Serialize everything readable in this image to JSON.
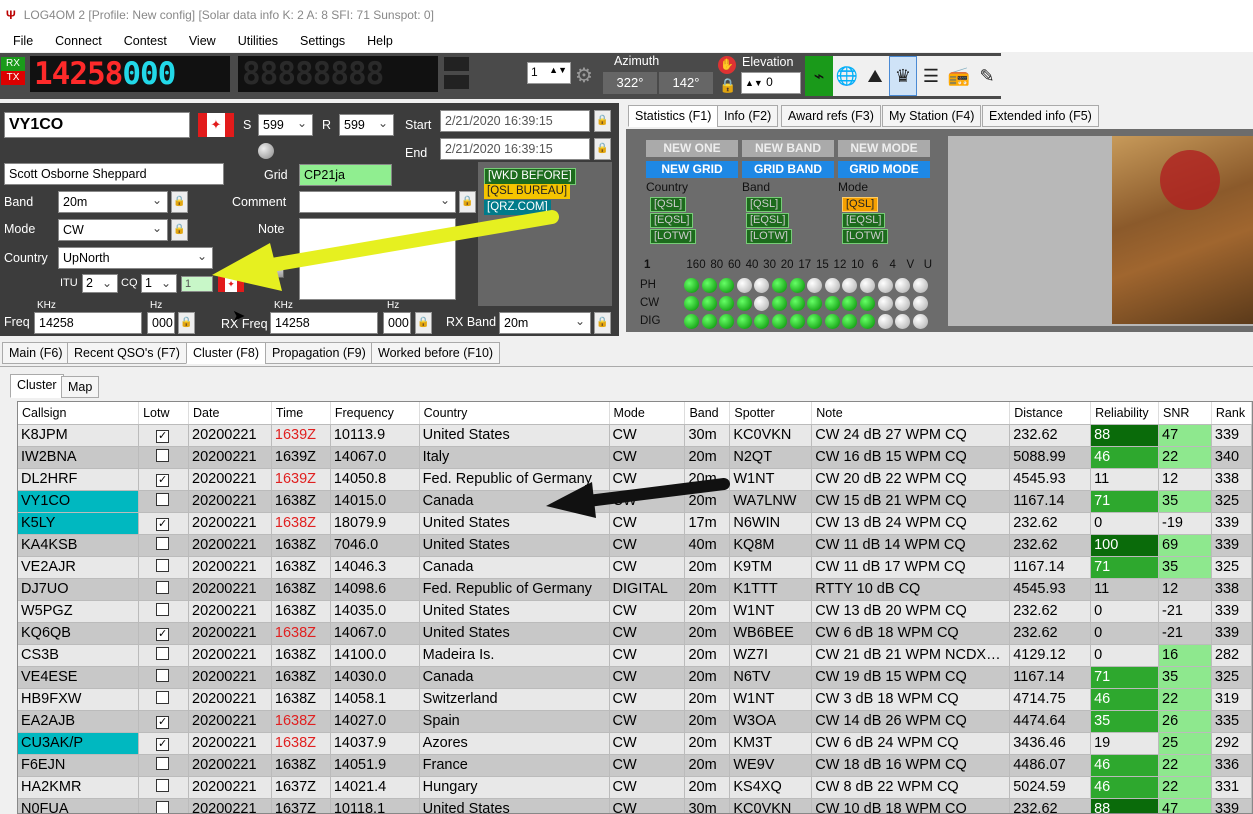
{
  "window": {
    "title": "LOG4OM 2 [Profile: New config] [Solar data info K: 2 A: 8 SFI: 71 Sunspot: 0]"
  },
  "menu": [
    "File",
    "Connect",
    "Contest",
    "View",
    "Utilities",
    "Settings",
    "Help"
  ],
  "radio": {
    "rx": "RX",
    "tx": "TX",
    "frequency_main": "14258",
    "frequency_frac": "000",
    "rig_num": "1",
    "azimuth_label": "Azimuth",
    "azimuth_1": "322°",
    "azimuth_2": "142°",
    "elevation_label": "Elevation",
    "elevation_value": "0"
  },
  "qso": {
    "callsign": "VY1CO",
    "s_label": "S",
    "s_value": "599",
    "r_label": "R",
    "r_value": "599",
    "start_label": "Start",
    "start_value": "2/21/2020 16:39:15",
    "end_label": "End",
    "end_value": "2/21/2020 16:39:15",
    "name": "Scott Osborne Sheppard",
    "grid_label": "Grid",
    "grid_value": "CP21ja",
    "band_label": "Band",
    "band_value": "20m",
    "comment_label": "Comment",
    "comment_value": "",
    "mode_label": "Mode",
    "mode_value": "CW",
    "note_label": "Note",
    "country_label": "Country",
    "country_value": "UpNorth",
    "itu_label": "ITU",
    "itu_value": "2",
    "cq_label": "CQ",
    "cq_value": "1",
    "cont_value": "1",
    "khz_label": "KHz",
    "hz_label": "Hz",
    "freq_label": "Freq",
    "freq_khz": "14258",
    "freq_hz": "000",
    "rxfreq_label": "RX Freq",
    "rxfreq_khz": "14258",
    "rxfreq_hz": "000",
    "rxband_label": "RX Band",
    "rxband_value": "20m",
    "badges": [
      "[WKD BEFORE]",
      "[QSL BUREAU]",
      "[QRZ.COM]"
    ]
  },
  "stats_tabs": [
    "Statistics (F1)",
    "Info (F2)",
    "Award refs (F3)",
    "My Station (F4)",
    "Extended info (F5)"
  ],
  "stats": {
    "row1": [
      "NEW ONE",
      "NEW BAND",
      "NEW MODE"
    ],
    "row2": [
      "NEW GRID",
      "GRID BAND",
      "GRID MODE"
    ],
    "col_labels": [
      "Country",
      "Band",
      "Mode"
    ],
    "qsl": "[QSL]",
    "eqsl": "[EQSL]",
    "lotw": "[LOTW]",
    "bands_num": "1",
    "bands": [
      "160",
      "80",
      "60",
      "40",
      "30",
      "20",
      "17",
      "15",
      "12",
      "10",
      "6",
      "4",
      "V",
      "U"
    ],
    "modes": [
      "PH",
      "CW",
      "DIG"
    ]
  },
  "main_tabs": [
    "Main (F6)",
    "Recent QSO's (F7)",
    "Cluster (F8)",
    "Propagation (F9)",
    "Worked before (F10)"
  ],
  "sub_tabs": [
    "Cluster",
    "Map"
  ],
  "columns": [
    "Callsign",
    "Lotw",
    "Date",
    "Time",
    "Frequency",
    "Country",
    "Mode",
    "Band",
    "Spotter",
    "Note",
    "Distance",
    "Reliability",
    "SNR",
    "Rank"
  ],
  "rows": [
    [
      "K8JPM",
      true,
      "20200221",
      "1639Z",
      "10113.9",
      "United States",
      "CW",
      "30m",
      "KC0VKN",
      "CW 24 dB 27 WPM CQ",
      "232.62",
      "88",
      "47",
      "339"
    ],
    [
      "IW2BNA",
      false,
      "20200221",
      "1639Z",
      "14067.0",
      "Italy",
      "CW",
      "20m",
      "N2QT",
      "CW 16 dB 15 WPM CQ",
      "5088.99",
      "46",
      "22",
      "340"
    ],
    [
      "DL2HRF",
      true,
      "20200221",
      "1639Z",
      "14050.8",
      "Fed. Republic of Germany",
      "CW",
      "20m",
      "W1NT",
      "CW 20 dB 22 WPM CQ",
      "4545.93",
      "11",
      "12",
      "338"
    ],
    [
      "VY1CO",
      false,
      "20200221",
      "1638Z",
      "14015.0",
      "Canada",
      "CW",
      "20m",
      "WA7LNW",
      "CW 15 dB 21 WPM CQ",
      "1167.14",
      "71",
      "35",
      "325"
    ],
    [
      "K5LY",
      true,
      "20200221",
      "1638Z",
      "18079.9",
      "United States",
      "CW",
      "17m",
      "N6WIN",
      "CW 13 dB 24 WPM CQ",
      "232.62",
      "0",
      "-19",
      "339"
    ],
    [
      "KA4KSB",
      false,
      "20200221",
      "1638Z",
      "7046.0",
      "United States",
      "CW",
      "40m",
      "KQ8M",
      "CW 11 dB 14 WPM CQ",
      "232.62",
      "100",
      "69",
      "339"
    ],
    [
      "VE2AJR",
      false,
      "20200221",
      "1638Z",
      "14046.3",
      "Canada",
      "CW",
      "20m",
      "K9TM",
      "CW 11 dB 17 WPM CQ",
      "1167.14",
      "71",
      "35",
      "325"
    ],
    [
      "DJ7UO",
      false,
      "20200221",
      "1638Z",
      "14098.6",
      "Fed. Republic of Germany",
      "DIGITAL",
      "20m",
      "K1TTT",
      "RTTY  10 dB CQ",
      "4545.93",
      "11",
      "12",
      "338"
    ],
    [
      "W5PGZ",
      false,
      "20200221",
      "1638Z",
      "14035.0",
      "United States",
      "CW",
      "20m",
      "W1NT",
      "CW 13 dB 20 WPM CQ",
      "232.62",
      "0",
      "-21",
      "339"
    ],
    [
      "KQ6QB",
      true,
      "20200221",
      "1638Z",
      "14067.0",
      "United States",
      "CW",
      "20m",
      "WB6BEE",
      "CW  6 dB 18 WPM CQ",
      "232.62",
      "0",
      "-21",
      "339"
    ],
    [
      "CS3B",
      false,
      "20200221",
      "1638Z",
      "14100.0",
      "Madeira Is.",
      "CW",
      "20m",
      "WZ7I",
      "CW 21 dB 21 WPM NCDX…",
      "4129.12",
      "0",
      "16",
      "282"
    ],
    [
      "VE4ESE",
      false,
      "20200221",
      "1638Z",
      "14030.0",
      "Canada",
      "CW",
      "20m",
      "N6TV",
      "CW 19 dB 15 WPM CQ",
      "1167.14",
      "71",
      "35",
      "325"
    ],
    [
      "HB9FXW",
      false,
      "20200221",
      "1638Z",
      "14058.1",
      "Switzerland",
      "CW",
      "20m",
      "W1NT",
      "CW  3 dB 18 WPM CQ",
      "4714.75",
      "46",
      "22",
      "319"
    ],
    [
      "EA2AJB",
      true,
      "20200221",
      "1638Z",
      "14027.0",
      "Spain",
      "CW",
      "20m",
      "W3OA",
      "CW 14 dB 26 WPM CQ",
      "4474.64",
      "35",
      "26",
      "335"
    ],
    [
      "CU3AK/P",
      true,
      "20200221",
      "1638Z",
      "14037.9",
      "Azores",
      "CW",
      "20m",
      "KM3T",
      "CW  6 dB 24 WPM CQ",
      "3436.46",
      "19",
      "25",
      "292"
    ],
    [
      "F6EJN",
      false,
      "20200221",
      "1638Z",
      "14051.9",
      "France",
      "CW",
      "20m",
      "WE9V",
      "CW 18 dB 16 WPM CQ",
      "4486.07",
      "46",
      "22",
      "336"
    ],
    [
      "HA2KMR",
      false,
      "20200221",
      "1637Z",
      "14021.4",
      "Hungary",
      "CW",
      "20m",
      "KS4XQ",
      "CW  8 dB 22 WPM CQ",
      "5024.59",
      "46",
      "22",
      "331"
    ],
    [
      "N0FUA",
      false,
      "20200221",
      "1637Z",
      "10118.1",
      "United States",
      "CW",
      "30m",
      "KC0VKN",
      "CW 10 dB 18 WPM CQ",
      "232.62",
      "88",
      "47",
      "339"
    ]
  ],
  "colors": {
    "accent_cyan": "#00b8c0",
    "time_red": "#e02020",
    "reliability_dark": "#0a6b0a",
    "reliability_light": "#2ea82e",
    "snr_green": "#8ee88e",
    "arrow_yellow": "#e6f020"
  }
}
